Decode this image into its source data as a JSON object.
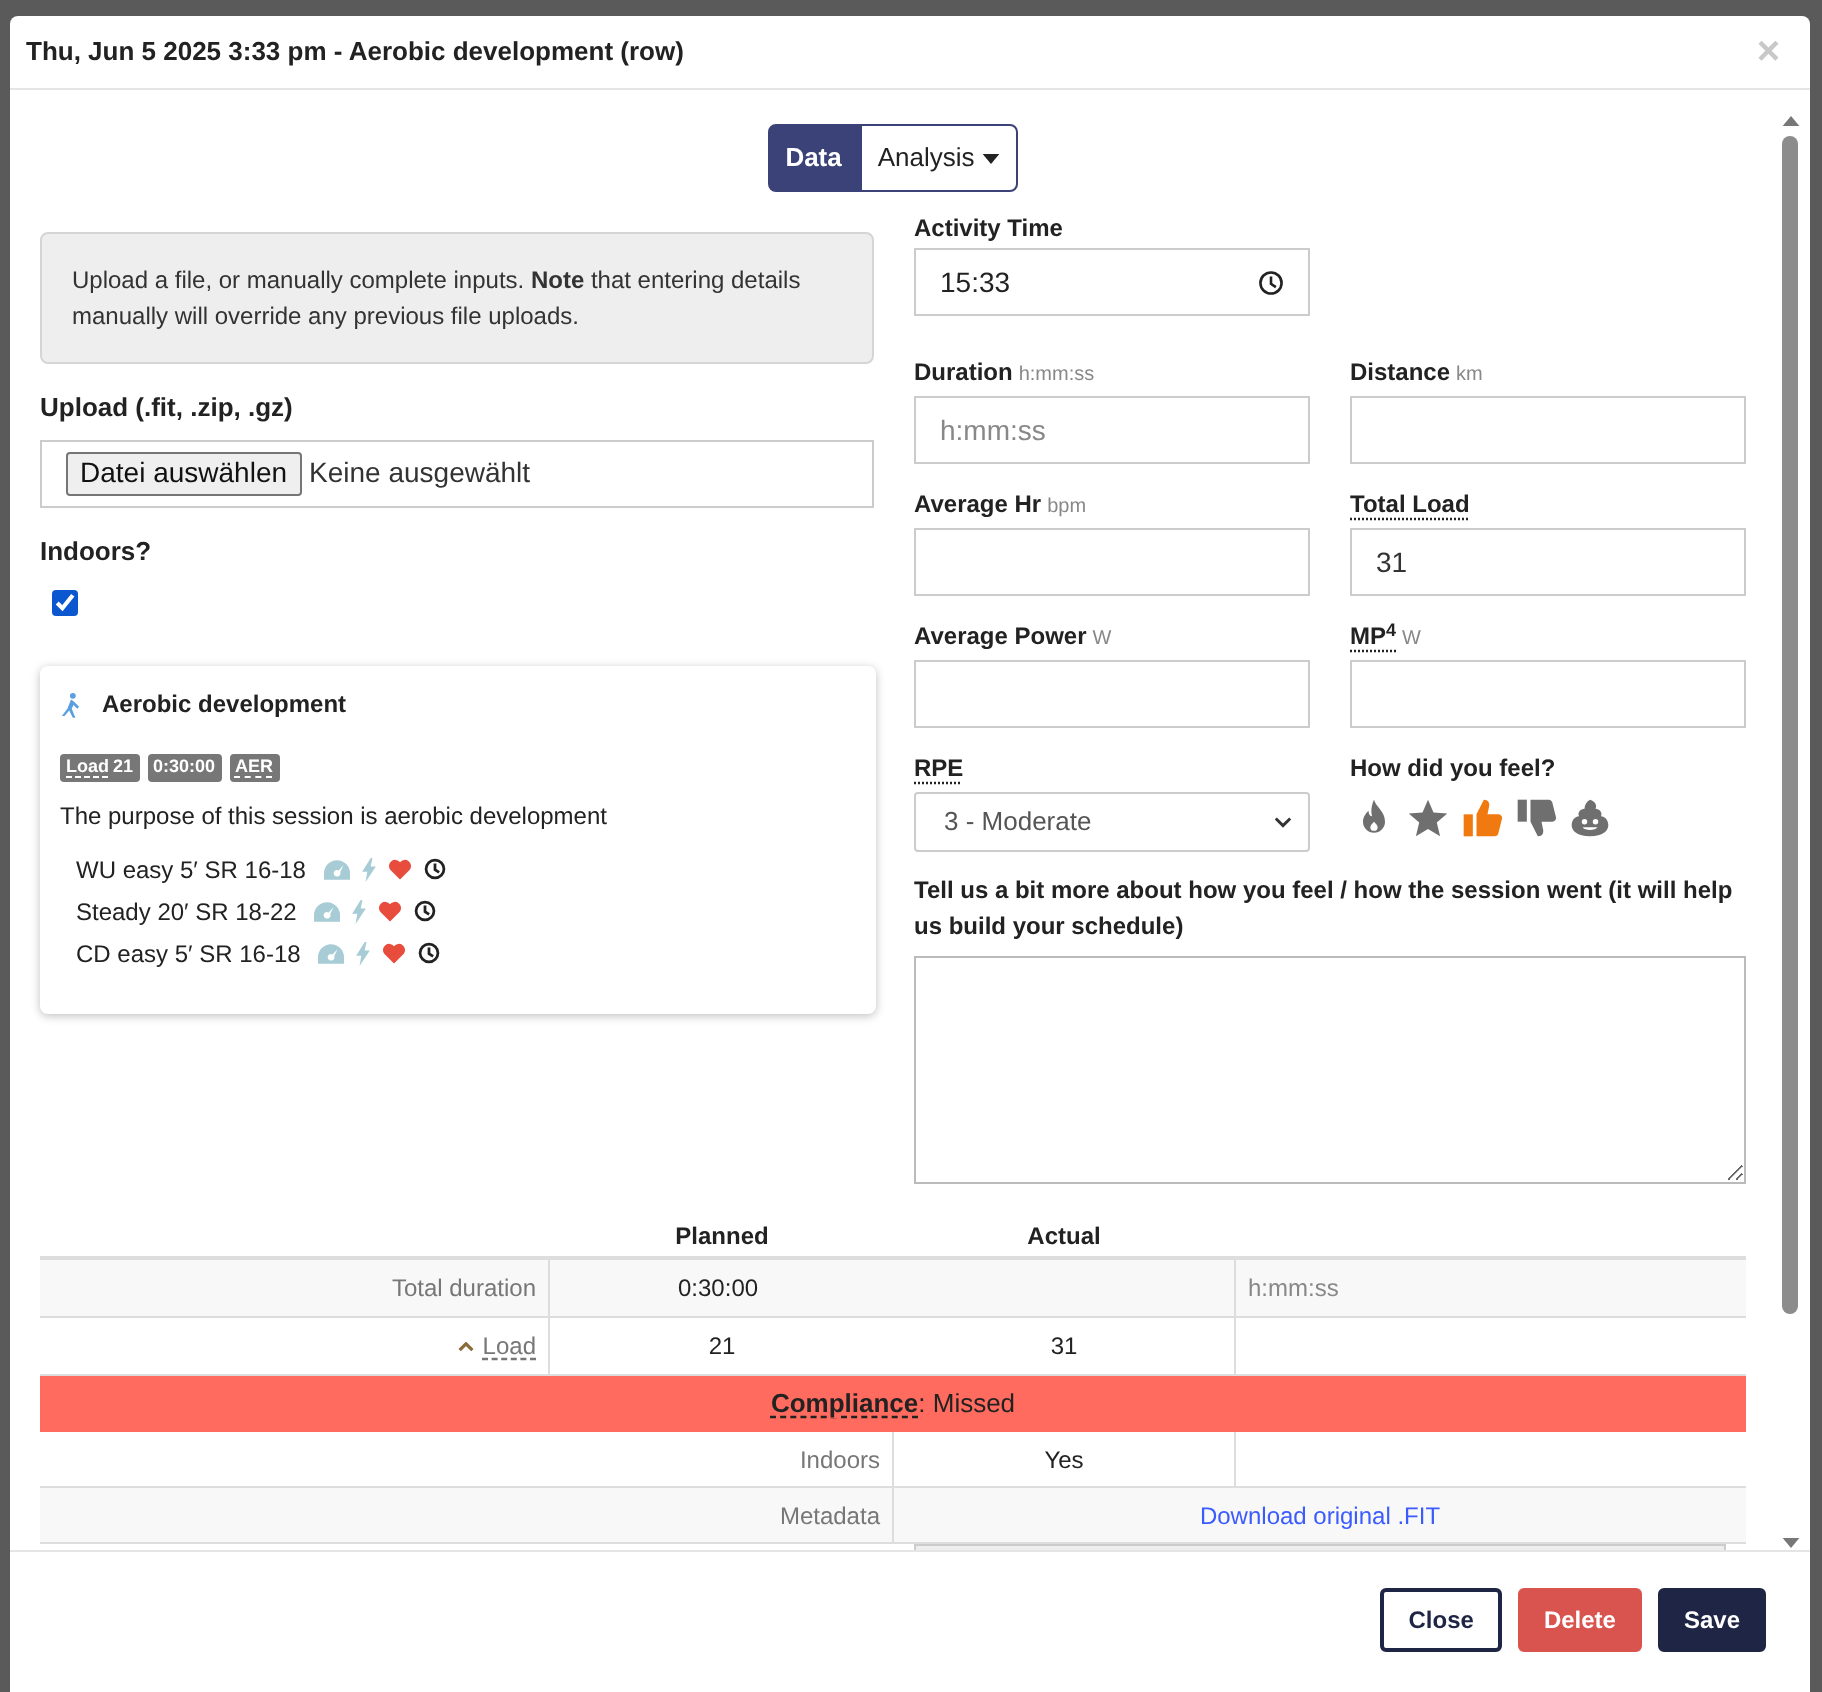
{
  "dialog": {
    "title": "Thu, Jun 5 2025 3:33 pm - Aerobic development (row)",
    "close": "×"
  },
  "view_tabs": [
    {
      "label": "Data",
      "selected": true,
      "dropdown": false
    },
    {
      "label": "Analysis",
      "selected": false,
      "dropdown": true
    }
  ],
  "info_note": "Upload a file, or manually complete inputs. **Note** that entering details manually will override any previous file uploads.",
  "upload": {
    "label": "Upload (.fit, .zip, .gz)",
    "button": "Datei auswählen",
    "status": "Keine ausgewählt"
  },
  "indoors": {
    "label": "Indoors?",
    "checked": true
  },
  "session_card": {
    "title": "Aerobic development",
    "badges": [
      {
        "label": "Load",
        "value": "21",
        "tooltip": true
      },
      {
        "label": "0:30:00",
        "tooltip": false
      },
      {
        "label": "AER",
        "tooltip": true
      }
    ],
    "description": "The purpose of this session is aerobic development",
    "steps": [
      {
        "text": "WU easy 5′ SR 16-18"
      },
      {
        "text": "Steady 20′ SR 18-22"
      },
      {
        "text": "CD easy 5′ SR 16-18"
      }
    ]
  },
  "activity_time": {
    "label": "Activity Time",
    "value": "15:33"
  },
  "fields": [
    {
      "kind": "input",
      "label": "Duration",
      "unit": "h:mm:ss",
      "tooltip": false,
      "placeholder": "h:mm:ss"
    },
    {
      "kind": "input",
      "label": "Distance",
      "unit": "km",
      "tooltip": false
    },
    {
      "kind": "input",
      "label": "Average Hr",
      "unit": "bpm",
      "tooltip": false
    },
    {
      "kind": "input",
      "label": "Total Load",
      "tooltip": true,
      "value": "31"
    },
    {
      "kind": "input",
      "label": "Average Power",
      "unit": "W",
      "tooltip": false
    },
    {
      "kind": "input",
      "label": "MP$^{4}$",
      "unit": "W",
      "tooltip": true
    },
    {
      "kind": "select",
      "label": "RPE",
      "tooltip": true,
      "value": "3 - Moderate"
    },
    {
      "kind": "feelings",
      "label": "How did you feel?",
      "tooltip": false,
      "options": [
        {
          "kind": "fire",
          "selected": false
        },
        {
          "kind": "star",
          "selected": false
        },
        {
          "kind": "thumbs-up",
          "selected": true
        },
        {
          "kind": "thumbs-down",
          "selected": false
        },
        {
          "kind": "poop",
          "selected": false
        }
      ]
    }
  ],
  "notes": {
    "label": "Tell us a bit more about how you feel / how the session went (it will help us build your schedule)"
  },
  "comparison": {
    "columns": [
      "Planned",
      "Actual"
    ],
    "rows": [
      {
        "kind": "values",
        "label": "Total duration",
        "planned": "0:30:00",
        "placeholder": "h:mm:ss",
        "expandable": false
      },
      {
        "kind": "values",
        "label": "Load",
        "planned": "21",
        "actual": "31",
        "expandable": true
      },
      {
        "kind": "banner",
        "label": "Compliance",
        "value": ": Missed"
      },
      {
        "kind": "wide",
        "label": "Indoors",
        "value": "Yes"
      },
      {
        "kind": "link",
        "label": "Metadata",
        "value": "Download original .FIT"
      }
    ]
  },
  "footer_buttons": [
    {
      "kind": "outline",
      "label": "Close"
    },
    {
      "kind": "danger",
      "label": "Delete"
    },
    {
      "kind": "primary",
      "label": "Save"
    }
  ]
}
